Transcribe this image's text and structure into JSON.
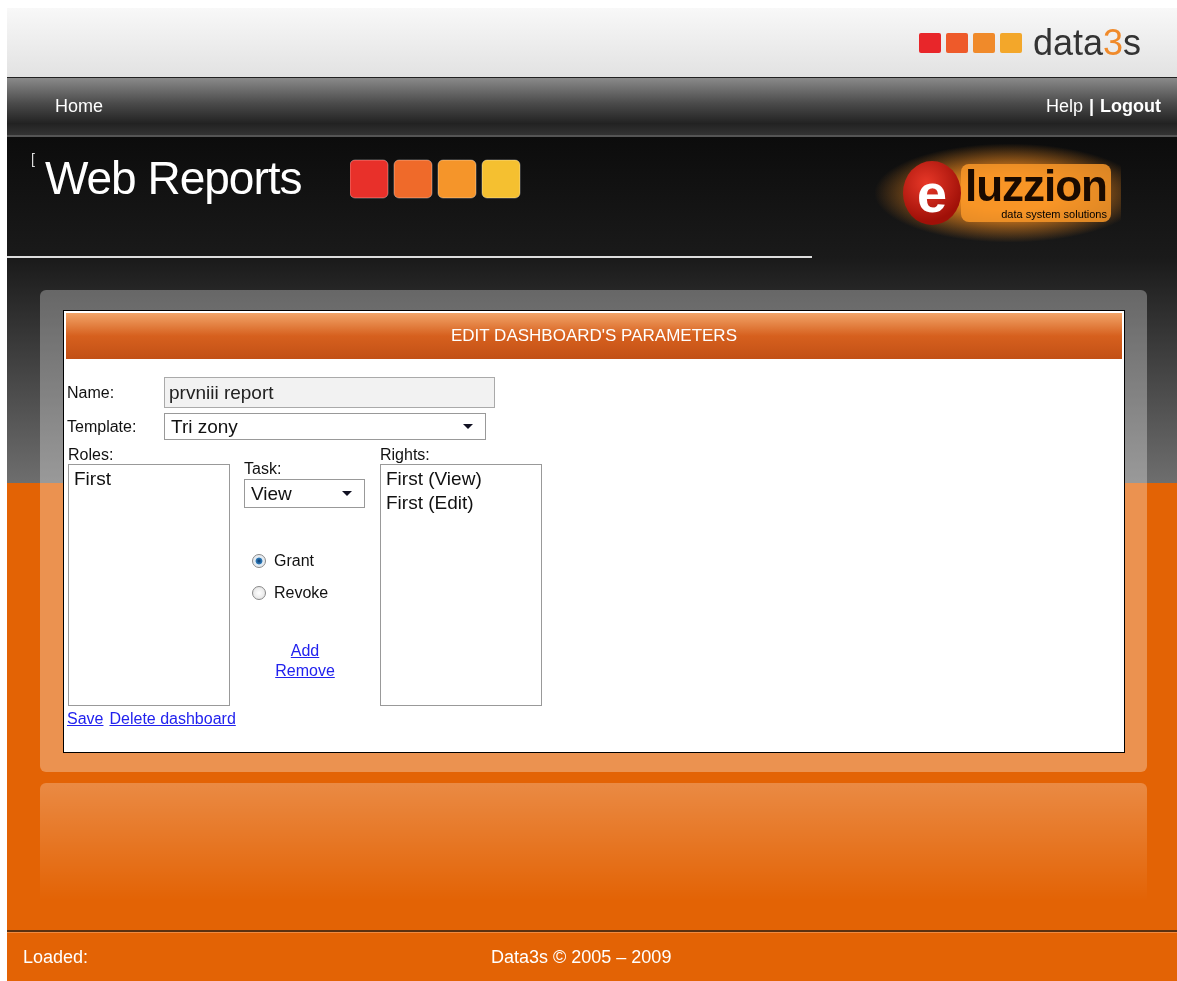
{
  "header": {
    "logo": {
      "before": "data",
      "accent": "3",
      "after": "s"
    }
  },
  "nav": {
    "left": [
      {
        "label": "Home"
      }
    ],
    "right": [
      {
        "label": "Help",
        "bold": false
      },
      {
        "label": "Logout",
        "bold": true
      }
    ],
    "separator": "|"
  },
  "banner": {
    "mark": "[",
    "title": "Web Reports",
    "brand": {
      "letter": "e",
      "name": "luzzion",
      "tagline": "data system solutions"
    }
  },
  "form": {
    "title": "EDIT DASHBOARD'S PARAMETERS",
    "name": {
      "label": "Name:",
      "value": "prvniii report"
    },
    "template": {
      "label": "Template:",
      "value": "Tri zony"
    },
    "roles": {
      "label": "Roles:",
      "items": [
        {
          "text": "First",
          "selected": false
        }
      ]
    },
    "task": {
      "label": "Task:",
      "value": "View"
    },
    "actions": [
      {
        "label": "Grant",
        "selected": true
      },
      {
        "label": "Revoke",
        "selected": false
      }
    ],
    "buttons": [
      {
        "label": "Add"
      },
      {
        "label": "Remove"
      }
    ],
    "rights": {
      "label": "Rights:",
      "items": [
        {
          "text": "First (View)",
          "selected": false
        },
        {
          "text": "First (Edit)",
          "selected": false
        }
      ]
    },
    "links": [
      {
        "label": "Save"
      },
      {
        "label": "Delete dashboard"
      }
    ]
  },
  "status_bar": {
    "left": "Loaded:",
    "center": "Data3s © 2005 – 2009"
  }
}
